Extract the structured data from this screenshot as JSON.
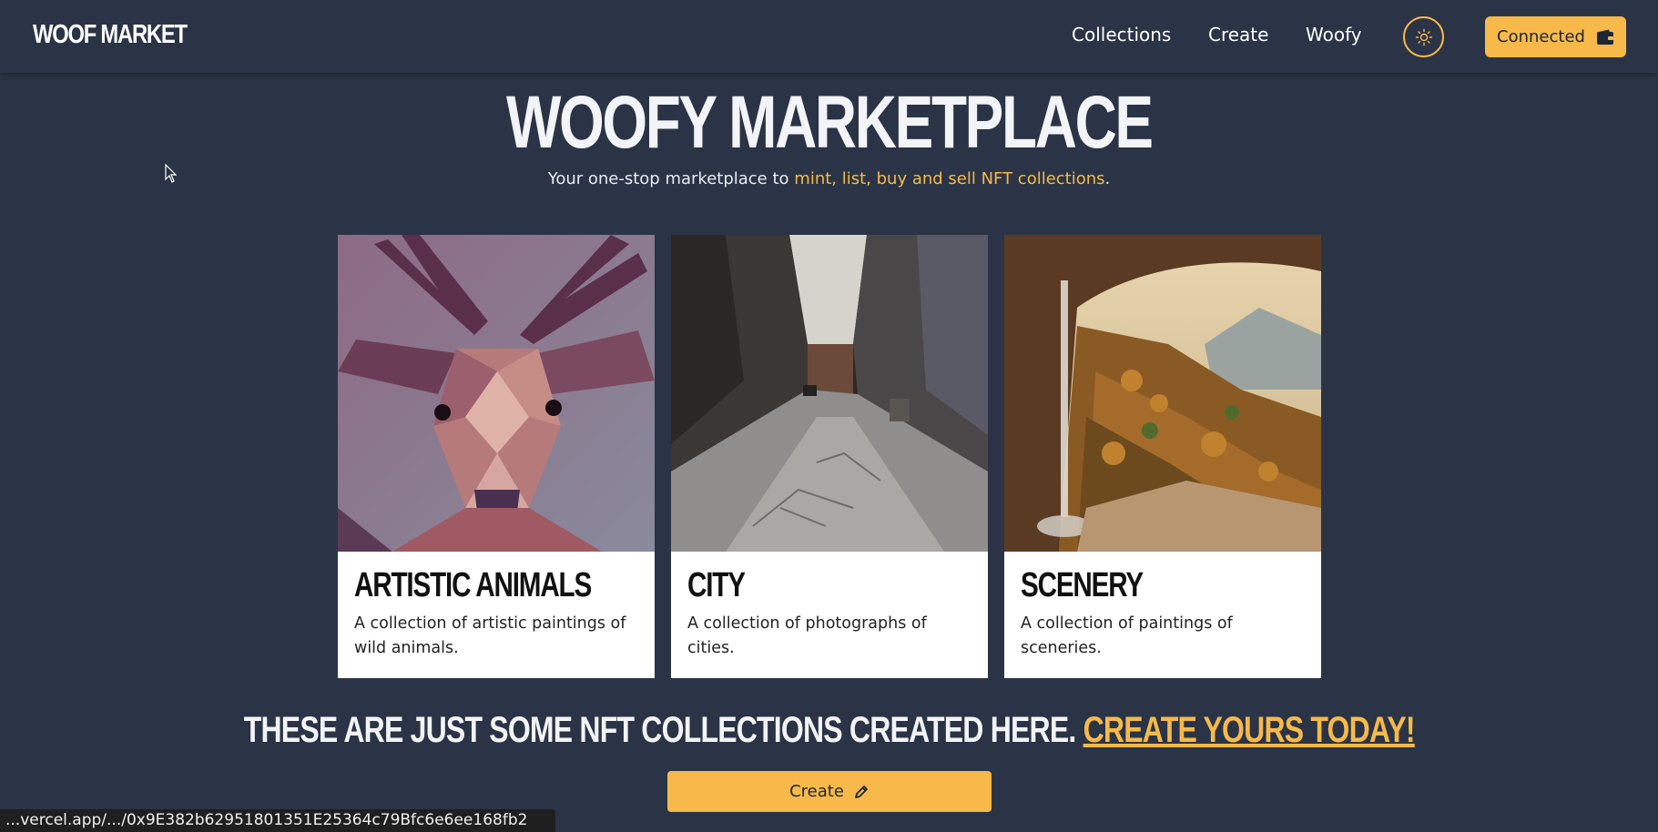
{
  "nav": {
    "logo": "WOOF MARKET",
    "links": [
      "Collections",
      "Create",
      "Woofy"
    ],
    "theme_icon": "sun-icon",
    "connect_label": "Connected",
    "connect_icon": "wallet-icon"
  },
  "hero": {
    "title": "WOOFY MARKETPLACE",
    "subtitle_prefix": "Your one-stop marketplace to ",
    "subtitle_accent": "mint, list, buy and sell NFT collections",
    "subtitle_suffix": "."
  },
  "collections": [
    {
      "title": "ARTISTIC ANIMALS",
      "description": "A collection of artistic paintings of wild animals."
    },
    {
      "title": "CITY",
      "description": "A collection of photographs of cities."
    },
    {
      "title": "SCENERY",
      "description": "A collection of paintings of sceneries."
    }
  ],
  "cta": {
    "text": "THESE ARE JUST SOME NFT COLLECTIONS CREATED HERE. ",
    "link": "CREATE YOURS TODAY!",
    "button_label": "Create",
    "button_icon": "pencil-icon"
  },
  "status_bar": {
    "url": "...vercel.app/.../0x9E382b62951801351E25364c79Bfc6e6ee168fb2"
  },
  "colors": {
    "background": "#2a3446",
    "accent": "#f6b94a",
    "card": "#ffffff"
  }
}
